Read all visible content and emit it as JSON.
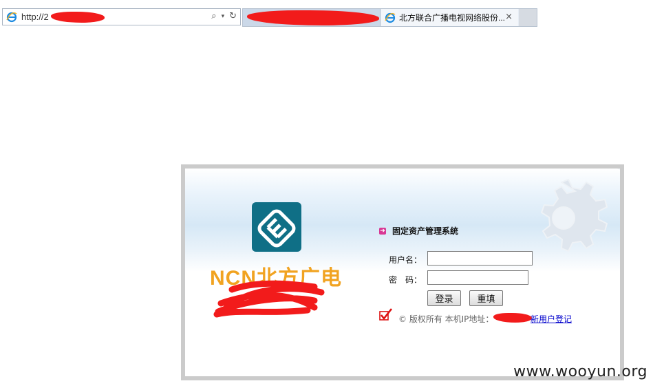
{
  "browser": {
    "address_bar": {
      "url_text": "http://2",
      "icons": [
        "ie-logo-icon",
        "search-icon",
        "dropdown-icon",
        "refresh-icon"
      ]
    },
    "tabs": [
      {
        "title": "",
        "active": false
      },
      {
        "title": "北方联合广播电视网络股份...",
        "active": true,
        "close_label": "×"
      }
    ]
  },
  "login": {
    "logo_text": "NCN北方广电",
    "system_title": "固定资产管理系统",
    "username_label": "用户名：",
    "password_label": "密　码：",
    "username_value": "",
    "password_value": "",
    "login_button": "登录",
    "reset_button": "重填",
    "copyright_text": "© 版权所有 本机IP地址：",
    "register_link": "新用户登记"
  },
  "watermark": "www.wooyun.org",
  "colors": {
    "logo_teal": "#0f6f86",
    "logo_orange": "#f1a321",
    "redaction_red": "#f21b1b",
    "link_blue": "#0000cc"
  }
}
